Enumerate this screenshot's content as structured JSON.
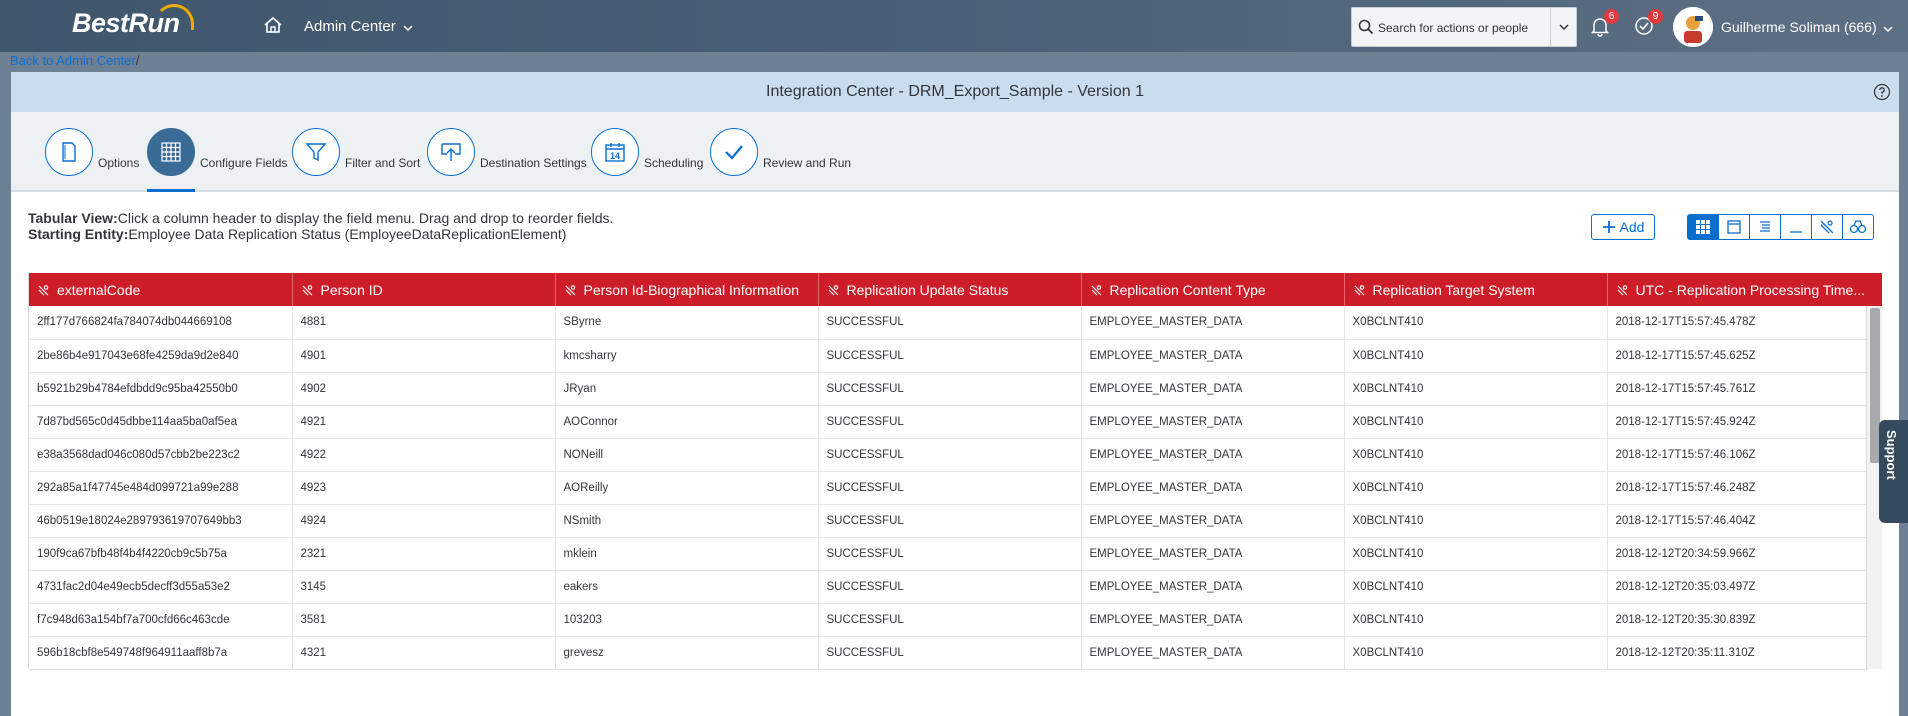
{
  "shell": {
    "logo": "BestRun",
    "app_title": "Admin Center",
    "search_placeholder": "Search for actions or people",
    "notifications_count": "6",
    "tasks_count": "9",
    "user_name": "Guilherme Soliman (666)"
  },
  "breadcrumb": {
    "link": "Back to Admin Center",
    "separator": "/"
  },
  "page_title": "Integration Center - DRM_Export_Sample - Version 1",
  "steps": [
    {
      "label": "Options",
      "icon": "document-icon"
    },
    {
      "label": "Configure Fields",
      "icon": "grid-icon",
      "active": true
    },
    {
      "label": "Filter and Sort",
      "icon": "filter-icon"
    },
    {
      "label": "Destination Settings",
      "icon": "upload-icon"
    },
    {
      "label": "Scheduling",
      "icon": "calendar-icon"
    },
    {
      "label": "Review and Run",
      "icon": "checkmark-icon"
    }
  ],
  "info": {
    "view_label": "Tabular View:",
    "view_text": "Click a column header to display the field menu. Drag and drop to reorder fields.",
    "entity_label": "Starting Entity:",
    "entity_text": "Employee Data Replication Status (EmployeeDataReplicationElement)"
  },
  "toolbar": {
    "add_label": "Add"
  },
  "table": {
    "columns": [
      "externalCode",
      "Person ID",
      "Person Id-Biographical Information",
      "Replication Update Status",
      "Replication Content Type",
      "Replication Target System",
      "UTC - Replication Processing Time..."
    ],
    "rows": [
      [
        "2ff177d766824fa784074db044669108",
        "4881",
        "SByrne",
        "SUCCESSFUL",
        "EMPLOYEE_MASTER_DATA",
        "X0BCLNT410",
        "2018-12-17T15:57:45.478Z"
      ],
      [
        "2be86b4e917043e68fe4259da9d2e840",
        "4901",
        "kmcsharry",
        "SUCCESSFUL",
        "EMPLOYEE_MASTER_DATA",
        "X0BCLNT410",
        "2018-12-17T15:57:45.625Z"
      ],
      [
        "b5921b29b4784efdbdd9c95ba42550b0",
        "4902",
        "JRyan",
        "SUCCESSFUL",
        "EMPLOYEE_MASTER_DATA",
        "X0BCLNT410",
        "2018-12-17T15:57:45.761Z"
      ],
      [
        "7d87bd565c0d45dbbe114aa5ba0af5ea",
        "4921",
        "AOConnor",
        "SUCCESSFUL",
        "EMPLOYEE_MASTER_DATA",
        "X0BCLNT410",
        "2018-12-17T15:57:45.924Z"
      ],
      [
        "e38a3568dad046c080d57cbb2be223c2",
        "4922",
        "NONeill",
        "SUCCESSFUL",
        "EMPLOYEE_MASTER_DATA",
        "X0BCLNT410",
        "2018-12-17T15:57:46.106Z"
      ],
      [
        "292a85a1f47745e484d099721a99e288",
        "4923",
        "AOReilly",
        "SUCCESSFUL",
        "EMPLOYEE_MASTER_DATA",
        "X0BCLNT410",
        "2018-12-17T15:57:46.248Z"
      ],
      [
        "46b0519e18024e289793619707649bb3",
        "4924",
        "NSmith",
        "SUCCESSFUL",
        "EMPLOYEE_MASTER_DATA",
        "X0BCLNT410",
        "2018-12-17T15:57:46.404Z"
      ],
      [
        "190f9ca67bfb48f4b4f4220cb9c5b75a",
        "2321",
        "mklein",
        "SUCCESSFUL",
        "EMPLOYEE_MASTER_DATA",
        "X0BCLNT410",
        "2018-12-12T20:34:59.966Z"
      ],
      [
        "4731fac2d04e49ecb5decff3d55a53e2",
        "3145",
        "eakers",
        "SUCCESSFUL",
        "EMPLOYEE_MASTER_DATA",
        "X0BCLNT410",
        "2018-12-12T20:35:03.497Z"
      ],
      [
        "f7c948d63a154bf7a700cfd66c463cde",
        "3581",
        "103203",
        "SUCCESSFUL",
        "EMPLOYEE_MASTER_DATA",
        "X0BCLNT410",
        "2018-12-12T20:35:30.839Z"
      ],
      [
        "596b18cbf8e549748f964911aaff8b7a",
        "4321",
        "grevesz",
        "SUCCESSFUL",
        "EMPLOYEE_MASTER_DATA",
        "X0BCLNT410",
        "2018-12-12T20:35:11.310Z"
      ]
    ]
  },
  "support_tab": "Support",
  "colors": {
    "header_red": "#cc1d28",
    "accent_blue": "#0a6ed1",
    "shell_bg": "#3f566d"
  }
}
